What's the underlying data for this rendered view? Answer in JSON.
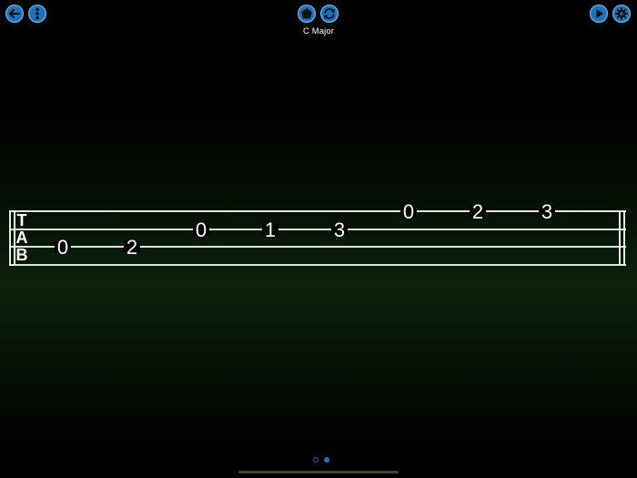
{
  "toolbar": {
    "left": [
      {
        "name": "back-button",
        "icon": "arrow-left-icon"
      },
      {
        "name": "more-options-button",
        "icon": "vertical-dots-icon"
      }
    ],
    "center": [
      {
        "name": "shape-button",
        "icon": "pentagon-icon"
      },
      {
        "name": "loop-button",
        "icon": "refresh-icon"
      }
    ],
    "right": [
      {
        "name": "play-button",
        "icon": "play-icon"
      },
      {
        "name": "settings-button",
        "icon": "gear-icon"
      }
    ],
    "accent_color": "#1e73b8"
  },
  "title": "C Major",
  "tab": {
    "clef": [
      "T",
      "A",
      "B"
    ],
    "strings": 4,
    "notes": [
      {
        "string": 3,
        "fret": "0"
      },
      {
        "string": 3,
        "fret": "2"
      },
      {
        "string": 2,
        "fret": "0"
      },
      {
        "string": 2,
        "fret": "1"
      },
      {
        "string": 2,
        "fret": "3"
      },
      {
        "string": 1,
        "fret": "0"
      },
      {
        "string": 1,
        "fret": "2"
      },
      {
        "string": 1,
        "fret": "3"
      }
    ]
  },
  "pager": {
    "pages": 2,
    "current": 2
  }
}
